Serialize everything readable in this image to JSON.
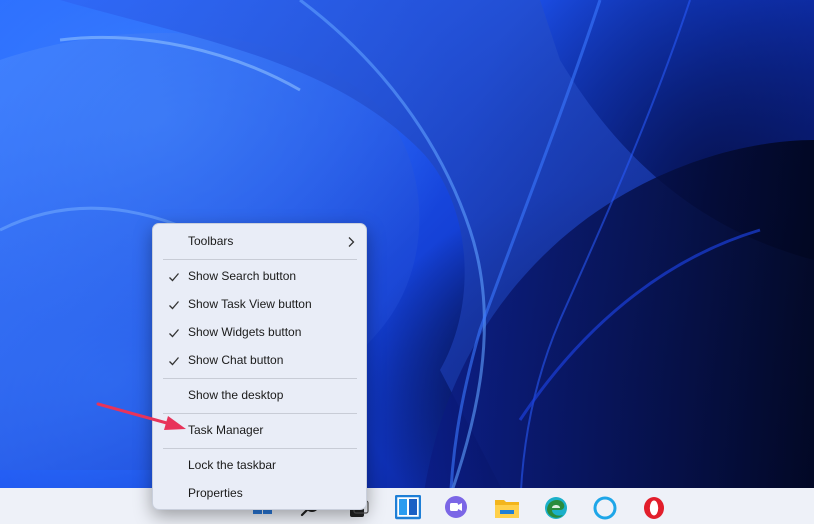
{
  "context_menu": {
    "items": [
      {
        "label": "Toolbars",
        "checked": false,
        "submenu": true
      },
      {
        "label": "Show Search button",
        "checked": true,
        "submenu": false
      },
      {
        "label": "Show Task View button",
        "checked": true,
        "submenu": false
      },
      {
        "label": "Show Widgets button",
        "checked": true,
        "submenu": false
      },
      {
        "label": "Show Chat button",
        "checked": true,
        "submenu": false
      },
      {
        "label": "Show the desktop",
        "checked": false,
        "submenu": false
      },
      {
        "label": "Task Manager",
        "checked": false,
        "submenu": false
      },
      {
        "label": "Lock the taskbar",
        "checked": false,
        "submenu": false
      },
      {
        "label": "Properties",
        "checked": false,
        "submenu": false
      }
    ]
  },
  "annotation": {
    "color": "#e8335a",
    "points_to": "Task Manager"
  },
  "taskbar": {
    "icons": [
      "start-icon",
      "search-icon",
      "task-view-icon",
      "widgets-icon",
      "chat-icon",
      "file-explorer-icon",
      "edge-icon",
      "cortana-icon",
      "opera-icon"
    ]
  },
  "colors": {
    "menu_bg": "#e9edf7",
    "taskbar_bg": "#eef1f8",
    "wallpaper_blue": "#1f55f0"
  }
}
